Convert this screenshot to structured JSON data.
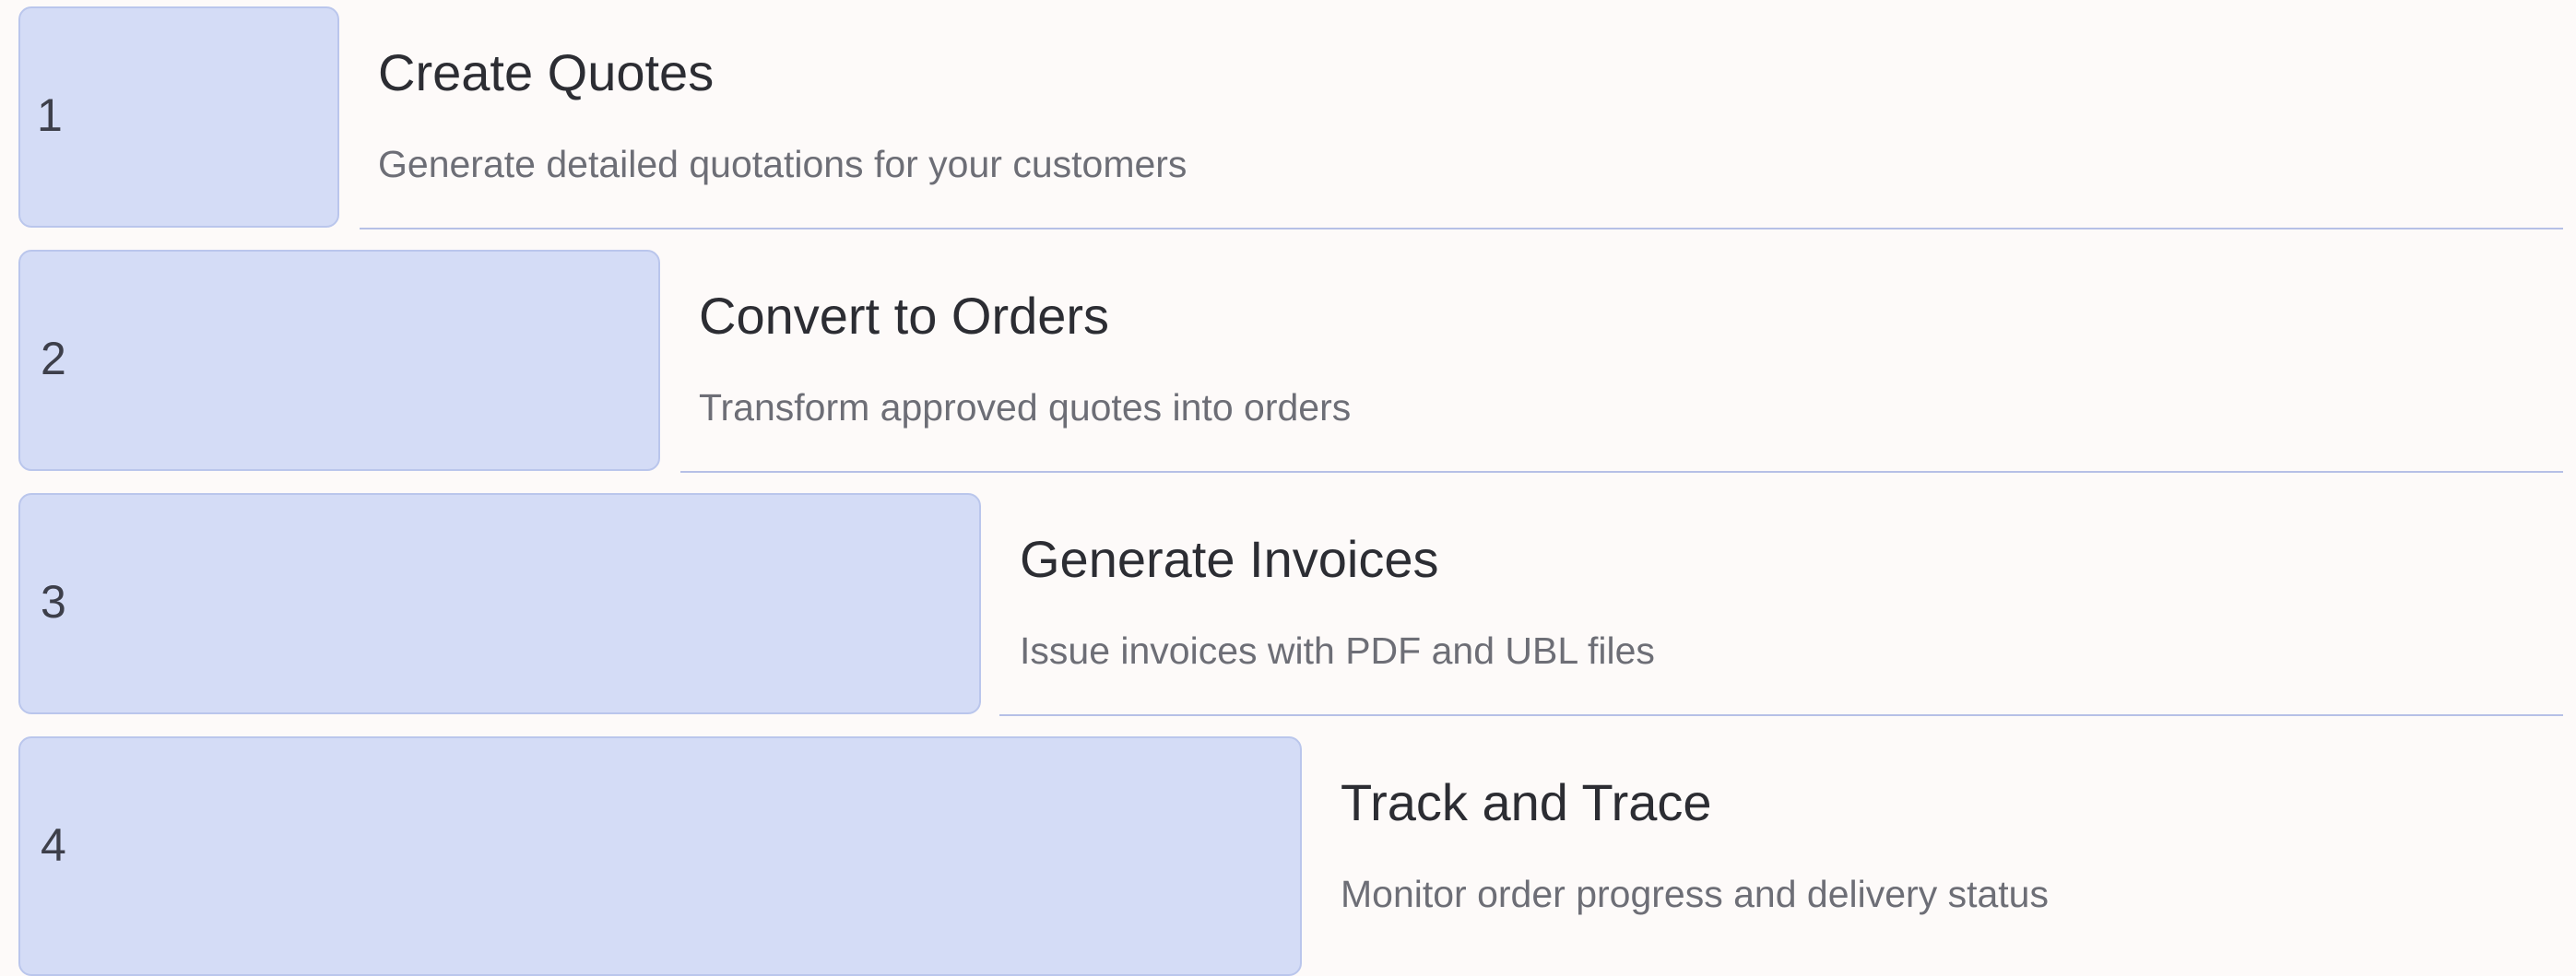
{
  "steps": [
    {
      "number": "1",
      "title": "Create Quotes",
      "description": "Generate detailed quotations for your customers"
    },
    {
      "number": "2",
      "title": "Convert to Orders",
      "description": "Transform approved quotes into orders"
    },
    {
      "number": "3",
      "title": "Generate Invoices",
      "description": "Issue invoices with PDF and UBL files"
    },
    {
      "number": "4",
      "title": "Track and Trace",
      "description": "Monitor order progress and delivery status"
    }
  ],
  "colors": {
    "background": "#fdfaf9",
    "step_box": "#d4dcf6",
    "step_box_border": "#bac6ec",
    "divider": "#b6c0e6",
    "title_text": "#2c2d33",
    "description_text": "#6d6e76"
  }
}
